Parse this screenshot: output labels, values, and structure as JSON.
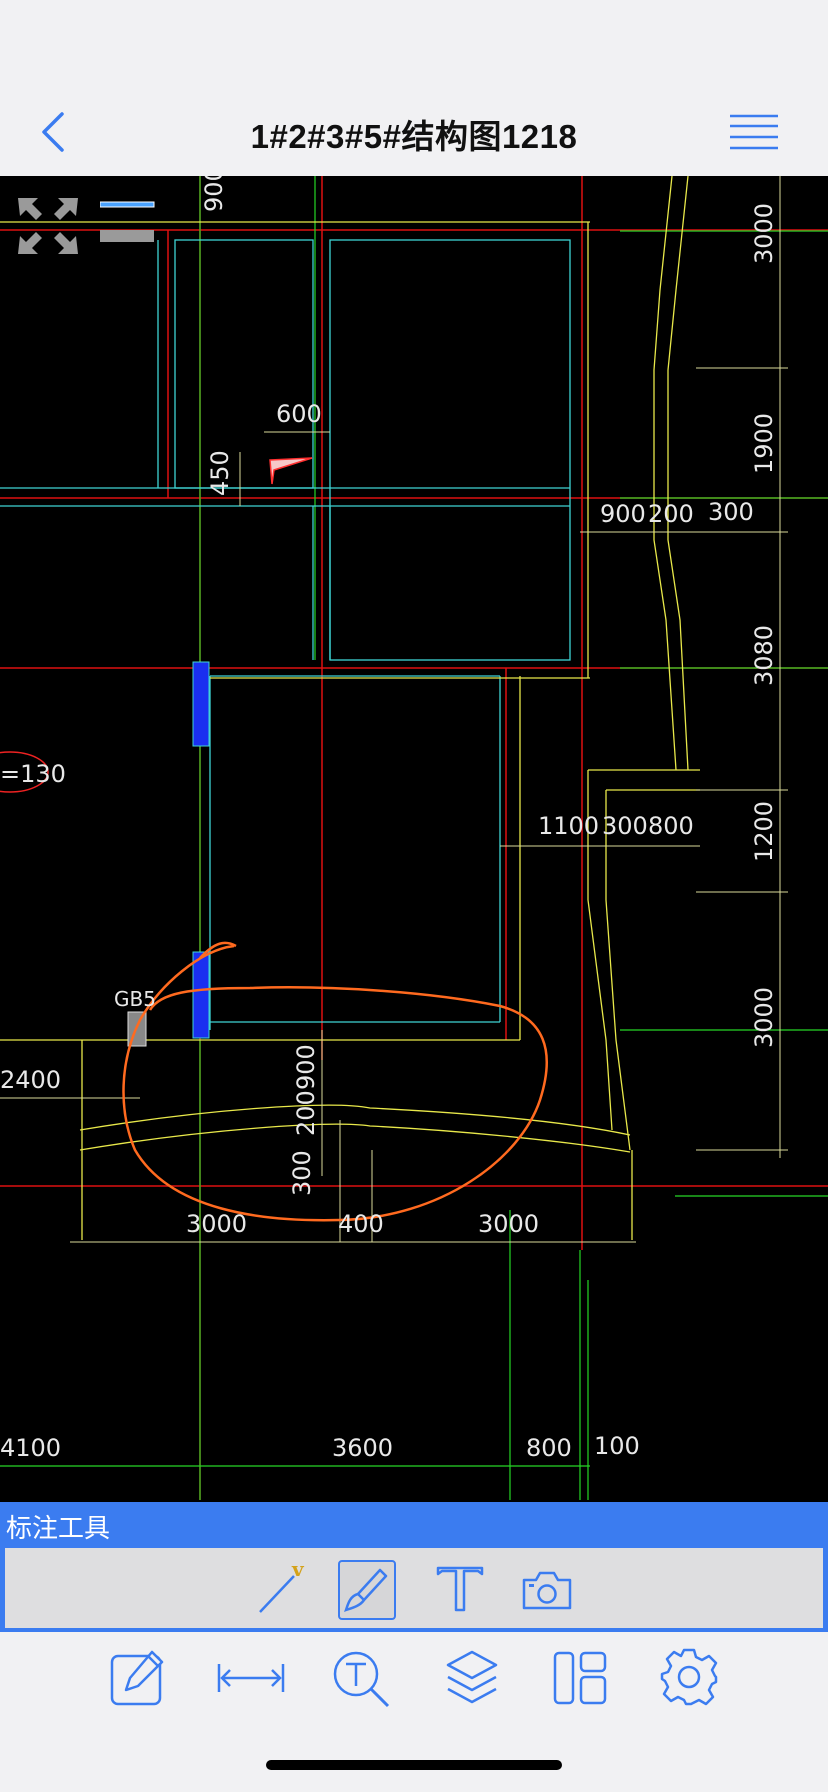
{
  "header": {
    "title": "1#2#3#5#结构图1218",
    "back_icon": "chevron-left-icon",
    "menu_icon": "hamburger-menu-icon"
  },
  "colors": {
    "accent": "#3b7cf0",
    "canvas_bg": "#000000",
    "annotation": "#ff6a1f"
  },
  "drawing": {
    "labels": {
      "d900_top": "900",
      "d3000_r1": "3000",
      "d600": "600",
      "d450": "450",
      "d1900": "1900",
      "d900_mid": "900",
      "d200_mid": "200",
      "d300_mid": "300",
      "d3080": "3080",
      "e130": "=130",
      "d1100": "1100",
      "d300_b": "300",
      "d800_b": "800",
      "d1200": "1200",
      "gb5": "GB5",
      "d3000_r2": "3000",
      "d2400": "2400",
      "d900_v": "900",
      "d200_v": "200",
      "d300_v": "300",
      "d3000_a": "3000",
      "d400": "400",
      "d3000_b": "3000",
      "d4100": "4100",
      "d3600": "3600",
      "d800_c": "800",
      "d100": "100"
    }
  },
  "annotation_panel": {
    "title": "标注工具",
    "tools": [
      {
        "name": "line-tool",
        "icon": "line-v-icon"
      },
      {
        "name": "pen-tool",
        "icon": "pen-icon",
        "selected": true
      },
      {
        "name": "text-tool",
        "icon": "text-t-icon"
      },
      {
        "name": "camera-tool",
        "icon": "camera-icon"
      }
    ]
  },
  "tabbar": {
    "items": [
      {
        "name": "annotate",
        "icon": "edit-icon"
      },
      {
        "name": "measure",
        "icon": "measure-icon"
      },
      {
        "name": "text-search",
        "icon": "text-search-icon"
      },
      {
        "name": "layers",
        "icon": "layers-icon"
      },
      {
        "name": "layout",
        "icon": "layout-icon"
      },
      {
        "name": "settings",
        "icon": "gear-icon"
      }
    ]
  }
}
